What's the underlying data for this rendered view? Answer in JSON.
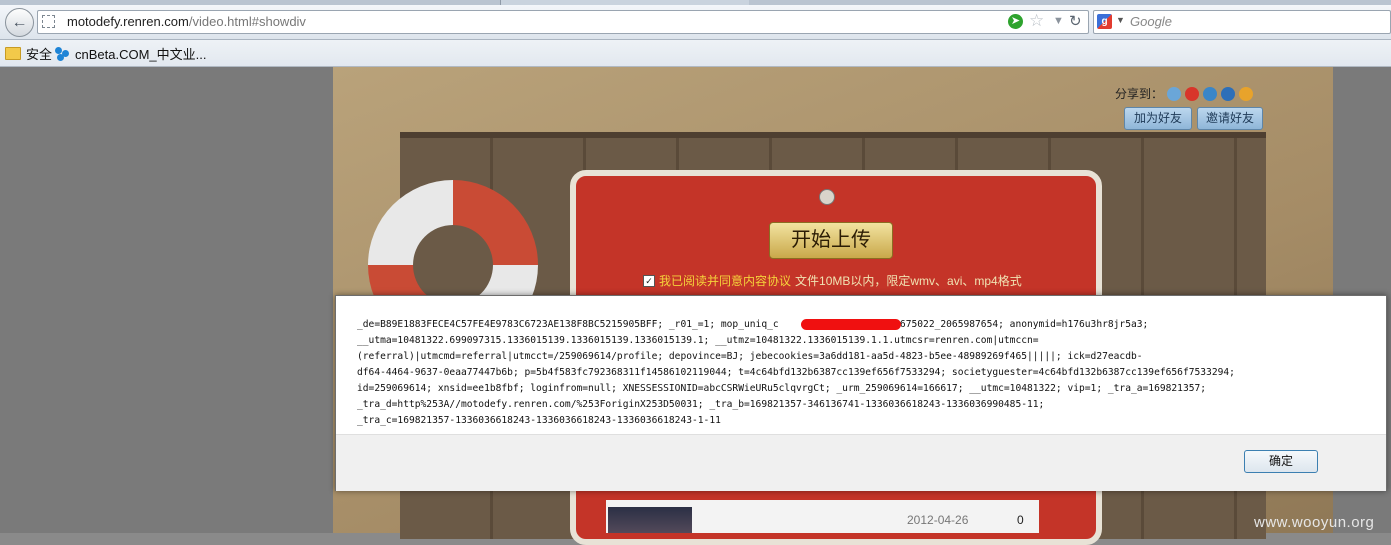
{
  "browser": {
    "url_host": "motodefy.renren.com",
    "url_path": "/video.html#showdiv",
    "search_placeholder": "Google"
  },
  "bookmarks": [
    {
      "label": "安全"
    },
    {
      "label": "cnBeta.COM_中文业..."
    }
  ],
  "page": {
    "share_label": "分享到：",
    "add_friend": "加为好友",
    "invite_friend": "邀请好友",
    "upload_button": "开始上传",
    "agree_link": "我已阅读并同意内容协议",
    "agree_note": "文件10MB以内，限定wmv、avi、mp4格式",
    "list_date": "2012-04-26",
    "list_count": "0"
  },
  "dialog": {
    "message": "_de=B89E1883FECE4C57FE4E9783C6723AE138F8BC5215905BFF; _r01_=1; mop_uniq_c                 1330675022_2065987654; anonymid=h176u3hr8jr5a3;\n__utma=10481322.699097315.1336015139.1336015139.1336015139.1; __utmz=10481322.1336015139.1.1.utmcsr=renren.com|utmccn=\n(referral)|utmcmd=referral|utmcct=/259069614/profile; depovince=BJ; jebecookies=3a6dd181-aa5d-4823-b5ee-48989269f465|||||; ick=d27eacdb-\ndf64-4464-9637-0eaa77447b6b; p=5b4f583fc792368311f14586102119044; t=4c64bfd132b6387cc139ef656f7533294; societyguester=4c64bfd132b6387cc139ef656f7533294;\nid=259069614; xnsid=ee1b8fbf; loginfrom=null; XNESSESSIONID=abcCSRWieURu5clqvrgCt; _urm_259069614=166617; __utmc=10481322; vip=1; _tra_a=169821357;\n_tra_d=http%253A//motodefy.renren.com/%253ForiginX253D50031; _tra_b=169821357-346136741-1336036618243-1336036990485-11;\n_tra_c=169821357-1336036618243-1336036618243-1336036618243-1-11",
    "ok_label": "确定"
  },
  "watermark": "www.wooyun.org"
}
